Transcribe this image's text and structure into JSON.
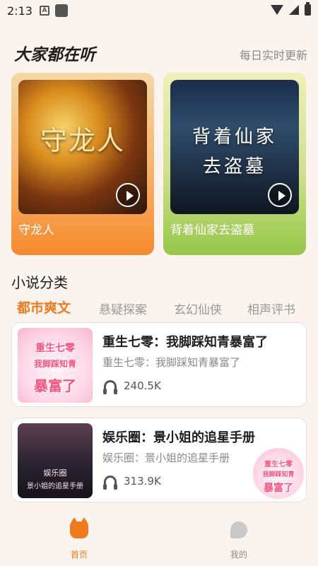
{
  "status_bar": {
    "time": "2:13",
    "notification_letter": "A"
  },
  "section": {
    "title": "大家都在听",
    "subtitle": "每日实时更新"
  },
  "featured": [
    {
      "cover_text": "守龙人",
      "caption": "守龙人"
    },
    {
      "cover_text_line1": "背着仙家",
      "cover_text_line2": "去盗墓",
      "caption": "背着仙家去盗墓"
    }
  ],
  "category": {
    "title": "小说分类",
    "tabs": [
      "都市爽文",
      "悬疑探案",
      "玄幻仙侠",
      "相声评书"
    ],
    "active_tab": "都市爽文"
  },
  "books": [
    {
      "title": "重生七零：我脚踩知青暴富了",
      "description": "重生七零：我脚踩知青暴富了",
      "plays": "240.5K",
      "cover_lines": [
        "重生七零",
        "我脚踩知青",
        "暴富了"
      ]
    },
    {
      "title": "娱乐圈：景小姐的追星手册",
      "description": "娱乐圈：景小姐的追星手册",
      "plays": "313.9K",
      "cover_lines": [
        "娱乐圈",
        "景小姐的追星手册"
      ]
    }
  ],
  "floating_cover_lines": [
    "重生七零",
    "我脚踩知青",
    "暴富了"
  ],
  "nav": {
    "home": "首页",
    "mine": "我的"
  },
  "colors": {
    "accent": "#f07a1e",
    "background": "#faf3ee",
    "muted": "#8a8a8a"
  }
}
